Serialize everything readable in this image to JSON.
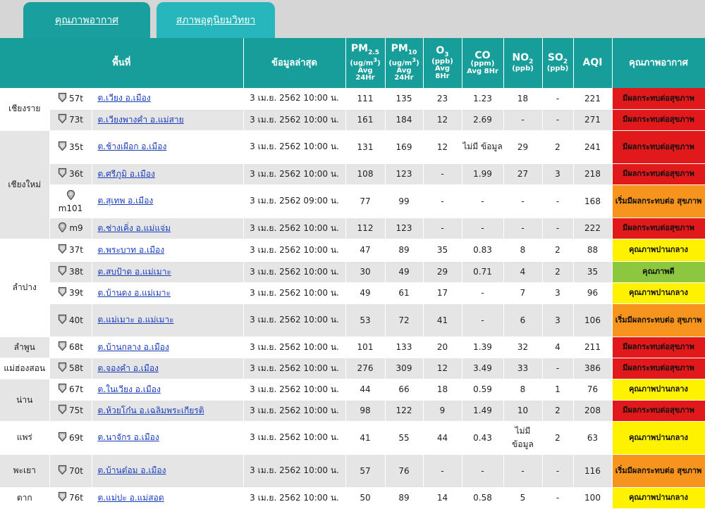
{
  "tabs": {
    "air_quality": "คุณภาพอากาศ",
    "weather": "สภาพอุตุนิยมวิทยา"
  },
  "headers": {
    "area": "พื้นที่",
    "latest": "ข้อมูลล่าสุด",
    "pm25_main": "PM",
    "pm25_sub": "2.5",
    "pm25_unit": "(ug/m",
    "pm25_unit_sup": "3",
    "pm25_unit_end": ")",
    "pm25_avg": "Avg",
    "pm25_hr": "24Hr",
    "pm10_main": "PM",
    "pm10_sub": "10",
    "pm10_unit": "(ug/m",
    "pm10_unit_sup": "3",
    "pm10_unit_end": ")",
    "pm10_avg": "Avg",
    "pm10_hr": "24Hr",
    "o3_main": "O",
    "o3_sub": "3",
    "o3_unit": "(ppb)",
    "o3_avg": "Avg",
    "o3_hr": "8Hr",
    "co_main": "CO",
    "co_unit": "(ppm)",
    "co_avg": "Avg 8Hr",
    "no2_main": "NO",
    "no2_sub": "2",
    "no2_unit": "(ppb)",
    "so2_main": "SO",
    "so2_sub": "2",
    "so2_unit": "(ppb)",
    "aqi": "AQI",
    "quality": "คุณภาพอากาศ"
  },
  "colors": {
    "header_bg": "#179e9b",
    "very_unhealthy": "#e2191b",
    "unhealthy_sensitive": "#f7941d",
    "moderate": "#fff200",
    "good": "#8dc63f"
  },
  "provinces": [
    {
      "name": "เชียงราย",
      "rows": [
        {
          "station": "57t",
          "location": "ต.เวียง อ.เมือง",
          "time": "3 เม.ย. 2562 10:00 น.",
          "pm25": "111",
          "pm10": "135",
          "o3": "23",
          "co": "1.23",
          "no2": "18",
          "so2": "-",
          "aqi": "221",
          "quality": "มีผลกระทบต่อสุขภาพ",
          "level": "red"
        },
        {
          "station": "73t",
          "location": "ต.เวียงพางคำ อ.แม่สาย",
          "time": "3 เม.ย. 2562 10:00 น.",
          "pm25": "161",
          "pm10": "184",
          "o3": "12",
          "co": "2.69",
          "no2": "-",
          "so2": "-",
          "aqi": "271",
          "quality": "มีผลกระทบต่อสุขภาพ",
          "level": "red"
        }
      ]
    },
    {
      "name": "เชียงใหม่",
      "rows": [
        {
          "station": "35t",
          "location": "ต.ช้างเผือก อ.เมือง",
          "time": "3 เม.ย. 2562 10:00 น.",
          "pm25": "131",
          "pm10": "169",
          "o3": "12",
          "co": "ไม่มี ข้อมูล",
          "no2": "29",
          "so2": "2",
          "aqi": "241",
          "quality": "มีผลกระทบต่อสุขภาพ",
          "level": "red"
        },
        {
          "station": "36t",
          "location": "ต.ศรีภูมิ อ.เมือง",
          "time": "3 เม.ย. 2562 10:00 น.",
          "pm25": "108",
          "pm10": "123",
          "o3": "-",
          "co": "1.99",
          "no2": "27",
          "so2": "3",
          "aqi": "218",
          "quality": "มีผลกระทบต่อสุขภาพ",
          "level": "red"
        },
        {
          "station": "m101",
          "location": "ต.สุเทพ อ.เมือง",
          "time": "3 เม.ย. 2562 09:00 น.",
          "pm25": "77",
          "pm10": "99",
          "o3": "-",
          "co": "-",
          "no2": "-",
          "so2": "-",
          "aqi": "168",
          "quality": "เริ่มมีผลกระทบต่อ สุขภาพ",
          "level": "orange"
        },
        {
          "station": "m9",
          "location": "ต.ช่างเคิ่ง อ.แม่แจ่ม",
          "time": "3 เม.ย. 2562 10:00 น.",
          "pm25": "112",
          "pm10": "123",
          "o3": "-",
          "co": "-",
          "no2": "-",
          "so2": "-",
          "aqi": "222",
          "quality": "มีผลกระทบต่อสุขภาพ",
          "level": "red"
        }
      ]
    },
    {
      "name": "ลำปาง",
      "rows": [
        {
          "station": "37t",
          "location": "ต.พระบาท อ.เมือง",
          "time": "3 เม.ย. 2562 10:00 น.",
          "pm25": "47",
          "pm10": "89",
          "o3": "35",
          "co": "0.83",
          "no2": "8",
          "so2": "2",
          "aqi": "88",
          "quality": "คุณภาพปานกลาง",
          "level": "yellow"
        },
        {
          "station": "38t",
          "location": "ต.สบป้าด อ.แม่เมาะ",
          "time": "3 เม.ย. 2562 10:00 น.",
          "pm25": "30",
          "pm10": "49",
          "o3": "29",
          "co": "0.71",
          "no2": "4",
          "so2": "2",
          "aqi": "35",
          "quality": "คุณภาพดี",
          "level": "green"
        },
        {
          "station": "39t",
          "location": "ต.บ้านดง อ.แม่เมาะ",
          "time": "3 เม.ย. 2562 10:00 น.",
          "pm25": "49",
          "pm10": "61",
          "o3": "17",
          "co": "-",
          "no2": "7",
          "so2": "3",
          "aqi": "96",
          "quality": "คุณภาพปานกลาง",
          "level": "yellow"
        },
        {
          "station": "40t",
          "location": "ต.แม่เมาะ อ.แม่เมาะ",
          "time": "3 เม.ย. 2562 10:00 น.",
          "pm25": "53",
          "pm10": "72",
          "o3": "41",
          "co": "-",
          "no2": "6",
          "so2": "3",
          "aqi": "106",
          "quality": "เริ่มมีผลกระทบต่อ สุขภาพ",
          "level": "orange"
        }
      ]
    },
    {
      "name": "ลำพูน",
      "rows": [
        {
          "station": "68t",
          "location": "ต.บ้านกลาง อ.เมือง",
          "time": "3 เม.ย. 2562 10:00 น.",
          "pm25": "101",
          "pm10": "133",
          "o3": "20",
          "co": "1.39",
          "no2": "32",
          "so2": "4",
          "aqi": "211",
          "quality": "มีผลกระทบต่อสุขภาพ",
          "level": "red"
        }
      ]
    },
    {
      "name": "แม่ฮ่องสอน",
      "rows": [
        {
          "station": "58t",
          "location": "ต.จองคำ อ.เมือง",
          "time": "3 เม.ย. 2562 10:00 น.",
          "pm25": "276",
          "pm10": "309",
          "o3": "12",
          "co": "3.49",
          "no2": "33",
          "so2": "-",
          "aqi": "386",
          "quality": "มีผลกระทบต่อสุขภาพ",
          "level": "red"
        }
      ]
    },
    {
      "name": "น่าน",
      "rows": [
        {
          "station": "67t",
          "location": "ต.ในเวียง อ.เมือง",
          "time": "3 เม.ย. 2562 10:00 น.",
          "pm25": "44",
          "pm10": "66",
          "o3": "18",
          "co": "0.59",
          "no2": "8",
          "so2": "1",
          "aqi": "76",
          "quality": "คุณภาพปานกลาง",
          "level": "yellow"
        },
        {
          "station": "75t",
          "location": "ต.ห้วยโก๋น อ.เฉลิมพระเกียรติ",
          "time": "3 เม.ย. 2562 10:00 น.",
          "pm25": "98",
          "pm10": "122",
          "o3": "9",
          "co": "1.49",
          "no2": "10",
          "so2": "2",
          "aqi": "208",
          "quality": "มีผลกระทบต่อสุขภาพ",
          "level": "red"
        }
      ]
    },
    {
      "name": "แพร่",
      "rows": [
        {
          "station": "69t",
          "location": "ต.นาจักร อ.เมือง",
          "time": "3 เม.ย. 2562 10:00 น.",
          "pm25": "41",
          "pm10": "55",
          "o3": "44",
          "co": "0.43",
          "no2": "ไม่มี ข้อมูล",
          "so2": "2",
          "aqi": "63",
          "quality": "คุณภาพปานกลาง",
          "level": "yellow"
        }
      ]
    },
    {
      "name": "พะเยา",
      "rows": [
        {
          "station": "70t",
          "location": "ต.บ้านต๋อม อ.เมือง",
          "time": "3 เม.ย. 2562 10:00 น.",
          "pm25": "57",
          "pm10": "76",
          "o3": "-",
          "co": "-",
          "no2": "-",
          "so2": "-",
          "aqi": "116",
          "quality": "เริ่มมีผลกระทบต่อ สุขภาพ",
          "level": "orange"
        }
      ]
    },
    {
      "name": "ตาก",
      "rows": [
        {
          "station": "76t",
          "location": "ต.แม่ปะ อ.แม่สอด",
          "time": "3 เม.ย. 2562 10:00 น.",
          "pm25": "50",
          "pm10": "89",
          "o3": "14",
          "co": "0.58",
          "no2": "5",
          "so2": "-",
          "aqi": "100",
          "quality": "คุณภาพปานกลาง",
          "level": "yellow"
        }
      ]
    }
  ]
}
